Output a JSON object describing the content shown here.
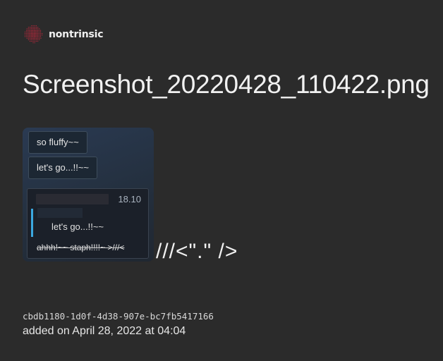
{
  "brand": {
    "name": "nontrinsic",
    "logo_icon": "dotted-sphere-icon",
    "logo_color": "#c0283d"
  },
  "file": {
    "title": "Screenshot_20220428_110422.png",
    "uuid": "cbdb1180-1d0f-4d38-907e-bc7fb5417166",
    "added": "added on April 28, 2022 at 04:04"
  },
  "preview": {
    "bubbles": [
      "so fluffy~~",
      "let's go...!!~~"
    ],
    "message": {
      "time": "18.10",
      "reply_text": "let's go...!!~~",
      "text": "ahhh!~~ staph!!!!~ >///<"
    },
    "overflow_text": "///<\".\" />",
    "accent_color": "#3ba8e0"
  }
}
